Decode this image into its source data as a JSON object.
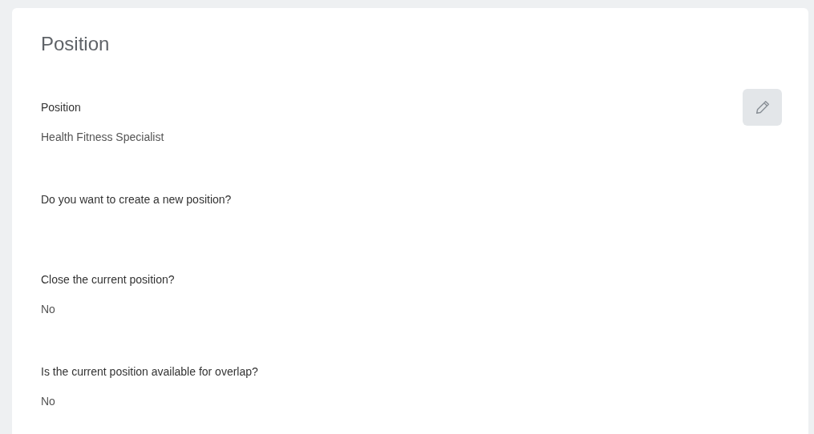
{
  "card": {
    "title": "Position",
    "fields": [
      {
        "label": "Position",
        "value": "Health Fitness Specialist"
      },
      {
        "label": "Do you want to create a new position?"
      },
      {
        "label": "Close the current position?",
        "value": "No"
      },
      {
        "label": "Is the current position available for overlap?",
        "value": "No"
      }
    ]
  }
}
